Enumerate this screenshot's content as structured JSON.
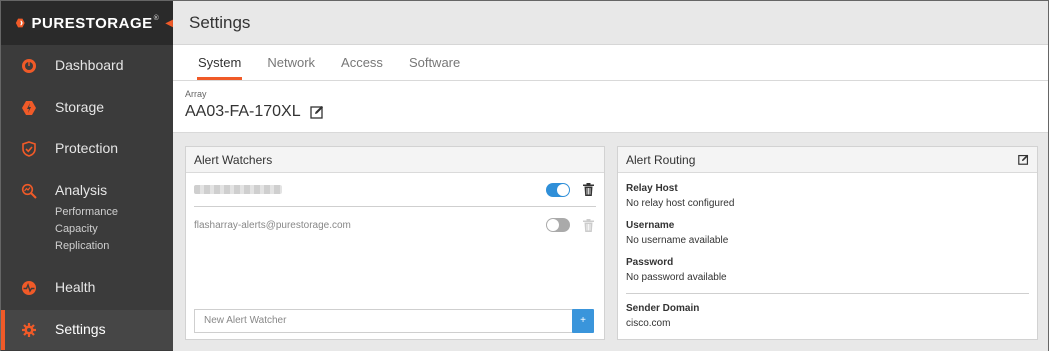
{
  "brand": {
    "name": "PURESTORAGE",
    "tm": "®",
    "accent": "#f05a28"
  },
  "sidebar": {
    "items": [
      {
        "label": "Dashboard",
        "icon": "dashboard-icon"
      },
      {
        "label": "Storage",
        "icon": "storage-icon"
      },
      {
        "label": "Protection",
        "icon": "shield-icon"
      },
      {
        "label": "Analysis",
        "icon": "analysis-icon"
      },
      {
        "label": "Health",
        "icon": "health-icon"
      },
      {
        "label": "Settings",
        "icon": "gear-icon"
      }
    ],
    "analysis_subitems": [
      "Performance",
      "Capacity",
      "Replication"
    ],
    "active": "Settings"
  },
  "header": {
    "title": "Settings"
  },
  "tabs": [
    "System",
    "Network",
    "Access",
    "Software"
  ],
  "active_tab": "System",
  "array": {
    "label": "Array",
    "name": "AA03-FA-170XL"
  },
  "alert_watchers": {
    "title": "Alert Watchers",
    "watchers": [
      {
        "email": "",
        "enabled": true
      },
      {
        "email": "flasharray-alerts@purestorage.com",
        "enabled": false
      }
    ],
    "new_placeholder": "New Alert Watcher",
    "add_label": "+"
  },
  "alert_routing": {
    "title": "Alert Routing",
    "relay_host": {
      "label": "Relay Host",
      "value": "No relay host configured"
    },
    "username": {
      "label": "Username",
      "value": "No username available"
    },
    "password": {
      "label": "Password",
      "value": "No password available"
    },
    "sender_domain": {
      "label": "Sender Domain",
      "value": "cisco.com"
    }
  }
}
